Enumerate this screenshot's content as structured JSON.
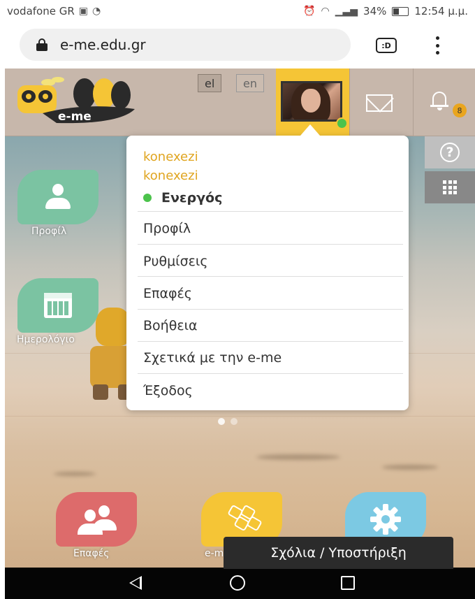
{
  "status_bar": {
    "carrier": "vodafone GR",
    "signal": "34%",
    "time": "12:54 μ.μ."
  },
  "browser": {
    "url": "e-me.edu.gr",
    "tab_icon_label": ":D"
  },
  "header": {
    "logo_text": "e-me",
    "lang_el": "el",
    "lang_en": "en",
    "notification_count": "8"
  },
  "dropdown": {
    "username_1": "konexezi",
    "username_2": "konexezi",
    "status": "Ενεργός",
    "items": [
      "Προφίλ",
      "Ρυθμίσεις",
      "Επαφές",
      "Βοήθεια",
      "Σχετικά με την e-me",
      "Έξοδος"
    ]
  },
  "desktop": {
    "apps": [
      {
        "label": "Προφίλ",
        "icon": "person-icon"
      },
      {
        "label": "Ημερολόγιο",
        "icon": "calendar-icon"
      },
      {
        "label": "Επαφές",
        "icon": "people-icon"
      },
      {
        "label": "e-m",
        "icon": "hive-icon"
      },
      {
        "label": "",
        "icon": "gear-icon"
      }
    ]
  },
  "side_buttons": {
    "help": "?"
  },
  "feedback": {
    "label": "Σχόλια / Υποστήριξη"
  },
  "colors": {
    "accent": "#f5c536",
    "header": "#c7b7ab",
    "online": "#4cc34c",
    "username": "#e0a520"
  }
}
